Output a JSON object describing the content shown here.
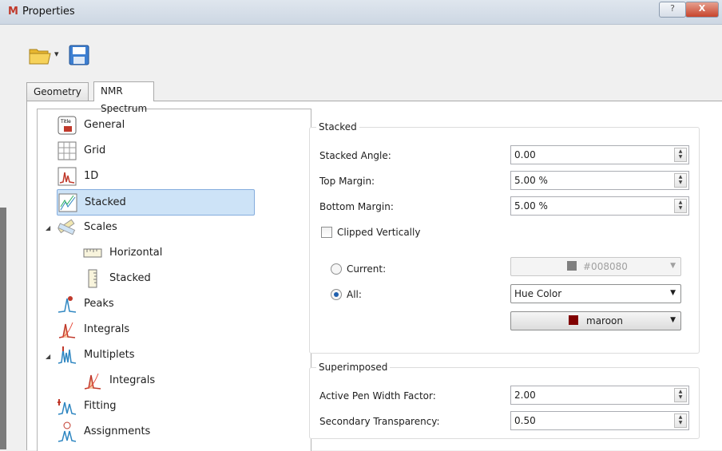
{
  "window": {
    "title": "Properties",
    "logo_text": "M",
    "help_label": "?",
    "close_label": "X"
  },
  "toolbar": {
    "open_icon": "folder-open-icon",
    "dropdown_arrow": "▾",
    "save_icon": "save-icon"
  },
  "tabs": [
    {
      "label": "Geometry",
      "active": false
    },
    {
      "label": "NMR Spectrum",
      "active": true
    }
  ],
  "tree": {
    "items": [
      {
        "label": "General",
        "icon": "title-icon",
        "selected": false
      },
      {
        "label": "Grid",
        "icon": "grid-icon",
        "selected": false
      },
      {
        "label": "1D",
        "icon": "spectrum-1d-icon",
        "selected": false
      },
      {
        "label": "Stacked",
        "icon": "stacked-spectra-icon",
        "selected": true
      },
      {
        "label": "Scales",
        "icon": "scales-icon",
        "selected": false,
        "expanded": true
      },
      {
        "label": "Horizontal",
        "icon": "horizontal-scale-icon",
        "selected": false
      },
      {
        "label": "Stacked",
        "icon": "vertical-scale-icon",
        "selected": false
      },
      {
        "label": "Peaks",
        "icon": "peaks-icon",
        "selected": false
      },
      {
        "label": "Integrals",
        "icon": "integrals-icon",
        "selected": false
      },
      {
        "label": "Multiplets",
        "icon": "multiplets-icon",
        "selected": false,
        "expanded": true
      },
      {
        "label": "Integrals",
        "icon": "integrals-icon",
        "selected": false
      },
      {
        "label": "Fitting",
        "icon": "fitting-icon",
        "selected": false
      },
      {
        "label": "Assignments",
        "icon": "assignments-icon",
        "selected": false
      }
    ]
  },
  "stacked": {
    "title": "Stacked",
    "angle_label": "Stacked Angle:",
    "angle_value": "0.00",
    "top_margin_label": "Top Margin:",
    "top_margin_value": "5.00 %",
    "bottom_margin_label": "Bottom Margin:",
    "bottom_margin_value": "5.00 %",
    "clipped_label": "Clipped Vertically",
    "clipped_checked": false,
    "current_label": "Current:",
    "current_color_value": "#008080",
    "current_color_swatch": "#808080",
    "all_label": "All:",
    "all_mode_value": "Hue Color",
    "all_color_value": "maroon",
    "all_color_swatch": "#800000"
  },
  "superimposed": {
    "title": "Superimposed",
    "pen_width_label": "Active Pen Width Factor:",
    "pen_width_value": "2.00",
    "transparency_label": "Secondary Transparency:",
    "transparency_value": "0.50"
  }
}
